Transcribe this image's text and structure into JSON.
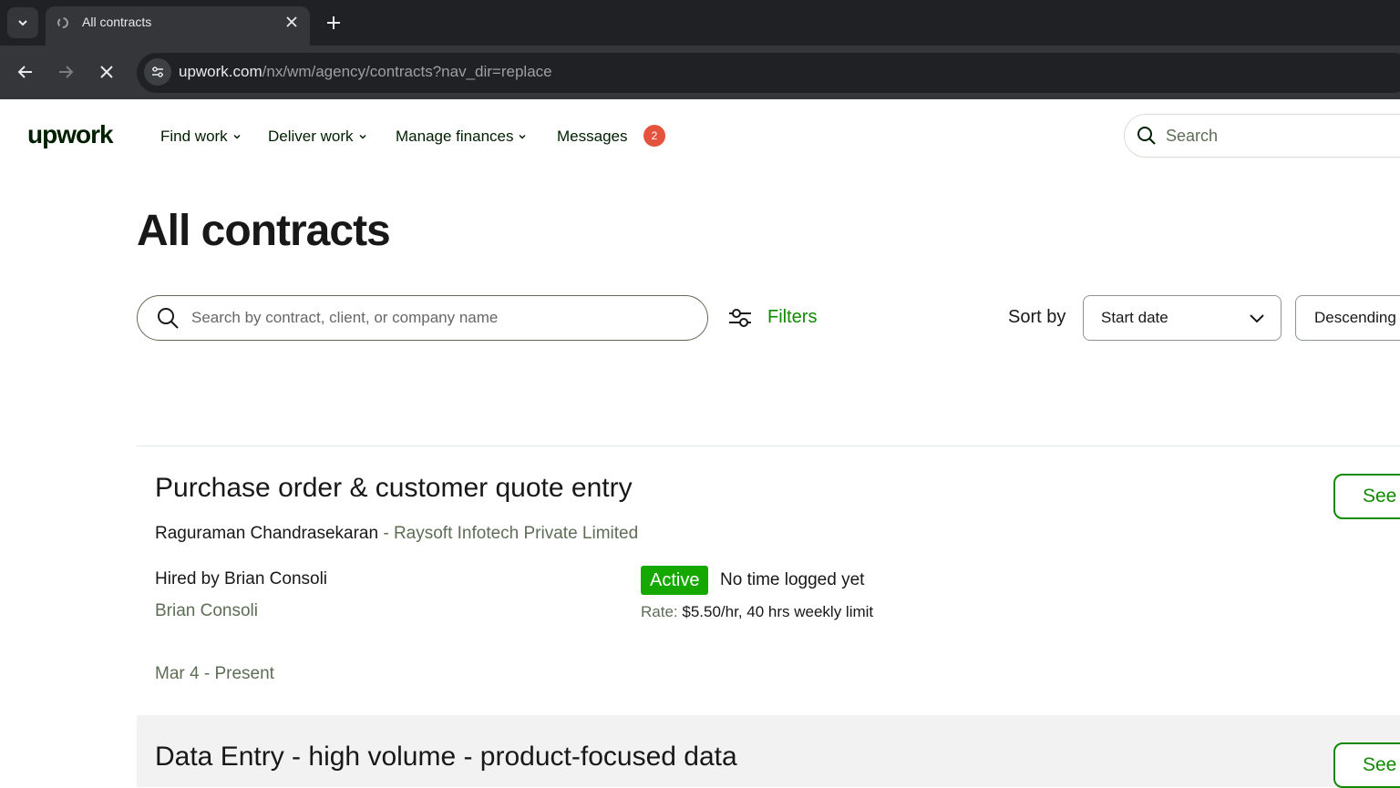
{
  "browser": {
    "tab_title": "All contracts",
    "url_host": "upwork.com",
    "url_path": "/nx/wm/agency/contracts?nav_dir=replace"
  },
  "header": {
    "logo": "upwork",
    "nav": {
      "find_work": "Find work",
      "deliver_work": "Deliver work",
      "manage_finances": "Manage finances",
      "messages": "Messages"
    },
    "messages_badge": "2",
    "search_placeholder": "Search"
  },
  "page": {
    "title": "All contracts",
    "search_placeholder": "Search by contract, client, or company name",
    "filters_label": "Filters",
    "sort_label": "Sort by",
    "sort_value": "Start date",
    "order_value": "Descending"
  },
  "contracts": [
    {
      "title": "Purchase order & customer quote entry",
      "client_name": "Raguraman Chandrasekaran",
      "separator": " - ",
      "company": "Raysoft Infotech Private Limited",
      "hired_by": "Hired by Brian Consoli",
      "contact": "Brian Consoli",
      "status": "Active",
      "time_logged": "No time logged yet",
      "rate_label": "Rate:",
      "rate_value": "$5.50/hr, 40 hrs weekly limit",
      "dates": "Mar 4 - Present",
      "action": "See"
    },
    {
      "title": "Data Entry - high volume - product-focused data",
      "action": "See"
    }
  ],
  "colors": {
    "brand_green": "#108a00",
    "active_green": "#14a800",
    "badge_red": "#e4533b"
  }
}
